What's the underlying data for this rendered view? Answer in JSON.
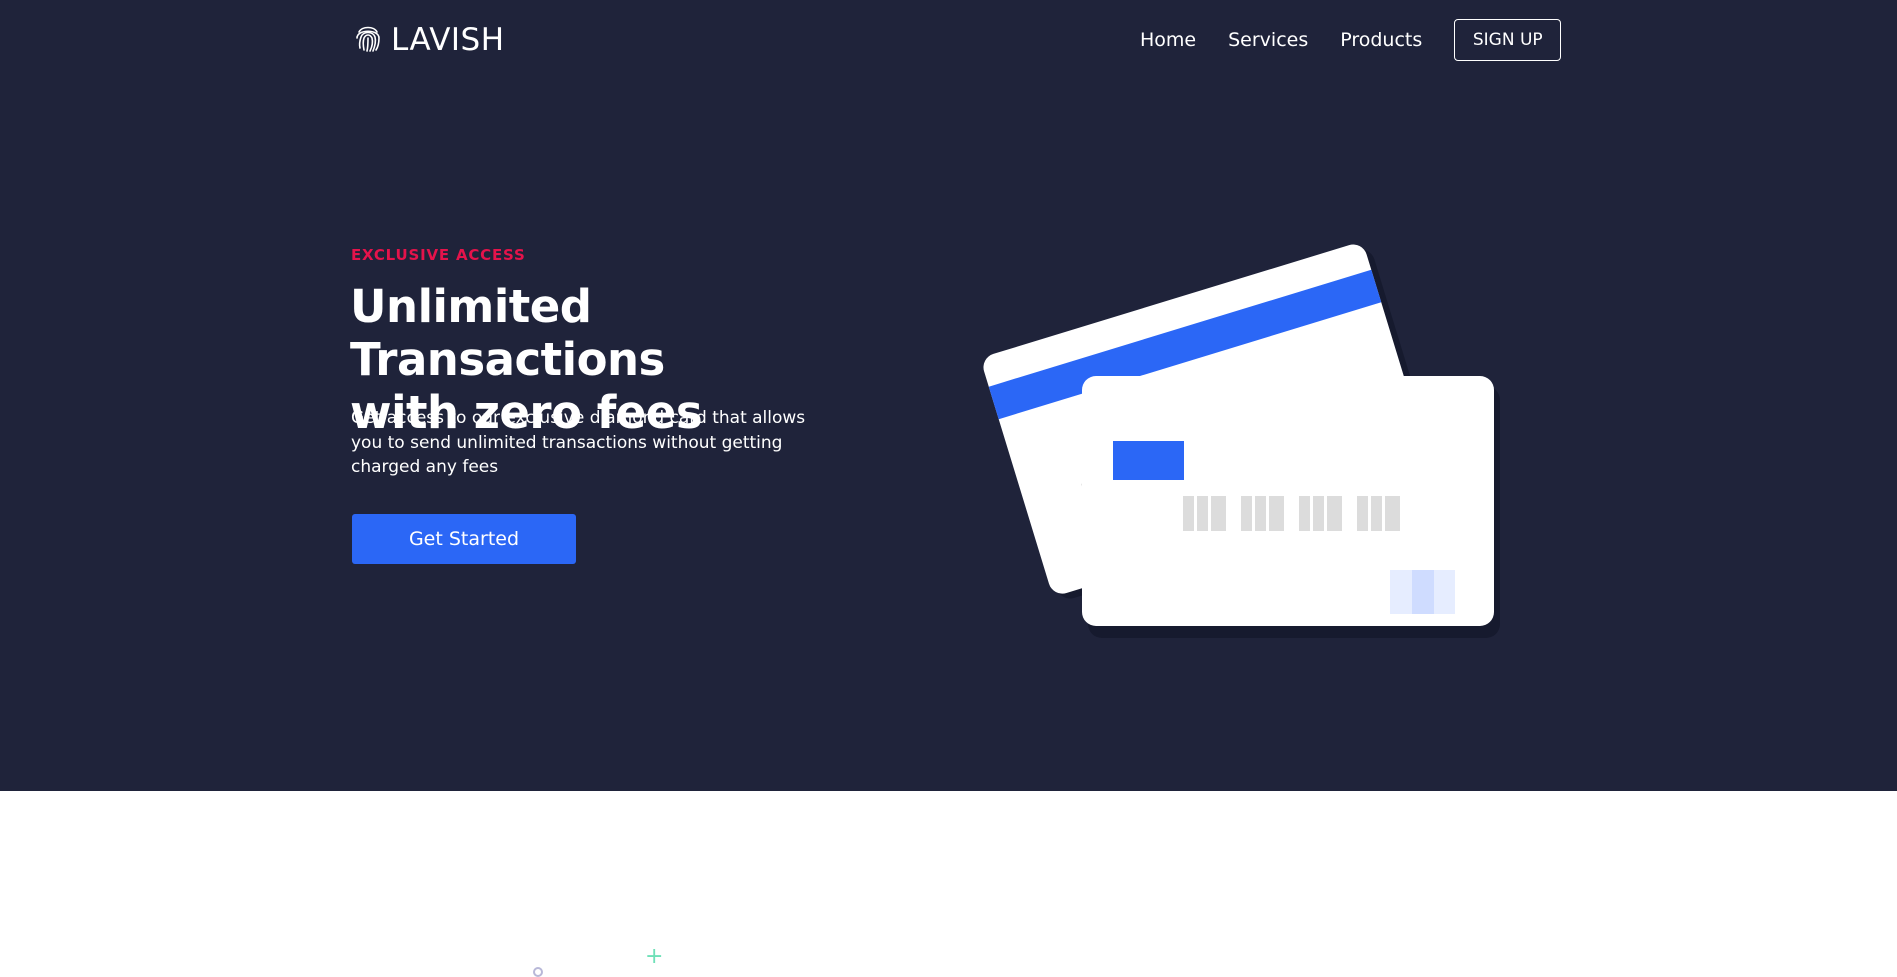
{
  "brand": {
    "name": "LAVISH",
    "icon": "fingerprint-icon"
  },
  "nav": {
    "items": [
      {
        "label": "Home"
      },
      {
        "label": "Services"
      },
      {
        "label": "Products"
      }
    ],
    "signup_label": "SIGN UP"
  },
  "hero": {
    "eyebrow": "EXCLUSIVE ACCESS",
    "headline_line1": "Unlimited Transactions",
    "headline_line2": "with zero fees",
    "description": "Get access to our exclusive diamond card that allows you to send unlimited transactions without getting charged any fees",
    "cta_label": "Get Started",
    "illustration": "credit-cards-illustration"
  },
  "colors": {
    "hero_bg": "#1f233a",
    "accent_blue": "#2b67f6",
    "eyebrow_red": "#e5134b",
    "page_bg": "#ffffff"
  }
}
